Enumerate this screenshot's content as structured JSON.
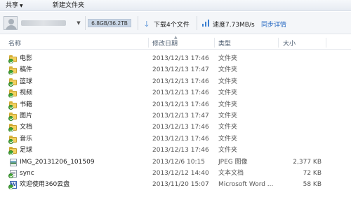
{
  "toolbar": {
    "share_label": "共享",
    "new_folder_label": "新建文件夹"
  },
  "account": {
    "quota": "6.8GB/36.2TB",
    "download_status": "下载4个文件",
    "speed": "速度7.73MB/s",
    "sync_details": "同步详情"
  },
  "columns": {
    "name": "名称",
    "date": "修改日期",
    "type": "类型",
    "size": "大小"
  },
  "files": [
    {
      "name": "电影",
      "date": "2013/12/13 17:46",
      "type": "文件夹",
      "size": "",
      "icon": "folder-icon"
    },
    {
      "name": "稿件",
      "date": "2013/12/13 17:47",
      "type": "文件夹",
      "size": "",
      "icon": "folder-icon"
    },
    {
      "name": "篮球",
      "date": "2013/12/13 17:46",
      "type": "文件夹",
      "size": "",
      "icon": "folder-icon"
    },
    {
      "name": "视频",
      "date": "2013/12/13 17:46",
      "type": "文件夹",
      "size": "",
      "icon": "folder-icon"
    },
    {
      "name": "书籍",
      "date": "2013/12/13 17:46",
      "type": "文件夹",
      "size": "",
      "icon": "folder-icon"
    },
    {
      "name": "图片",
      "date": "2013/12/13 17:47",
      "type": "文件夹",
      "size": "",
      "icon": "folder-icon"
    },
    {
      "name": "文档",
      "date": "2013/12/13 17:46",
      "type": "文件夹",
      "size": "",
      "icon": "folder-icon"
    },
    {
      "name": "音乐",
      "date": "2013/12/13 17:46",
      "type": "文件夹",
      "size": "",
      "icon": "folder-icon"
    },
    {
      "name": "足球",
      "date": "2013/12/13 17:46",
      "type": "文件夹",
      "size": "",
      "icon": "folder-icon"
    },
    {
      "name": "IMG_20131206_101509",
      "date": "2013/12/6 10:15",
      "type": "JPEG 图像",
      "size": "2,377 KB",
      "icon": "image-file-icon"
    },
    {
      "name": "sync",
      "date": "2013/12/12 14:40",
      "type": "文本文档",
      "size": "72 KB",
      "icon": "text-file-icon"
    },
    {
      "name": "欢迎使用360云盘",
      "date": "2013/11/20 15:07",
      "type": "Microsoft Word ...",
      "size": "58 KB",
      "icon": "word-doc-icon"
    }
  ],
  "colors": {
    "accent": "#3b7fd1",
    "link": "#2b6cc4",
    "folder": "#f3d15e",
    "sync_check": "#3fa634"
  }
}
